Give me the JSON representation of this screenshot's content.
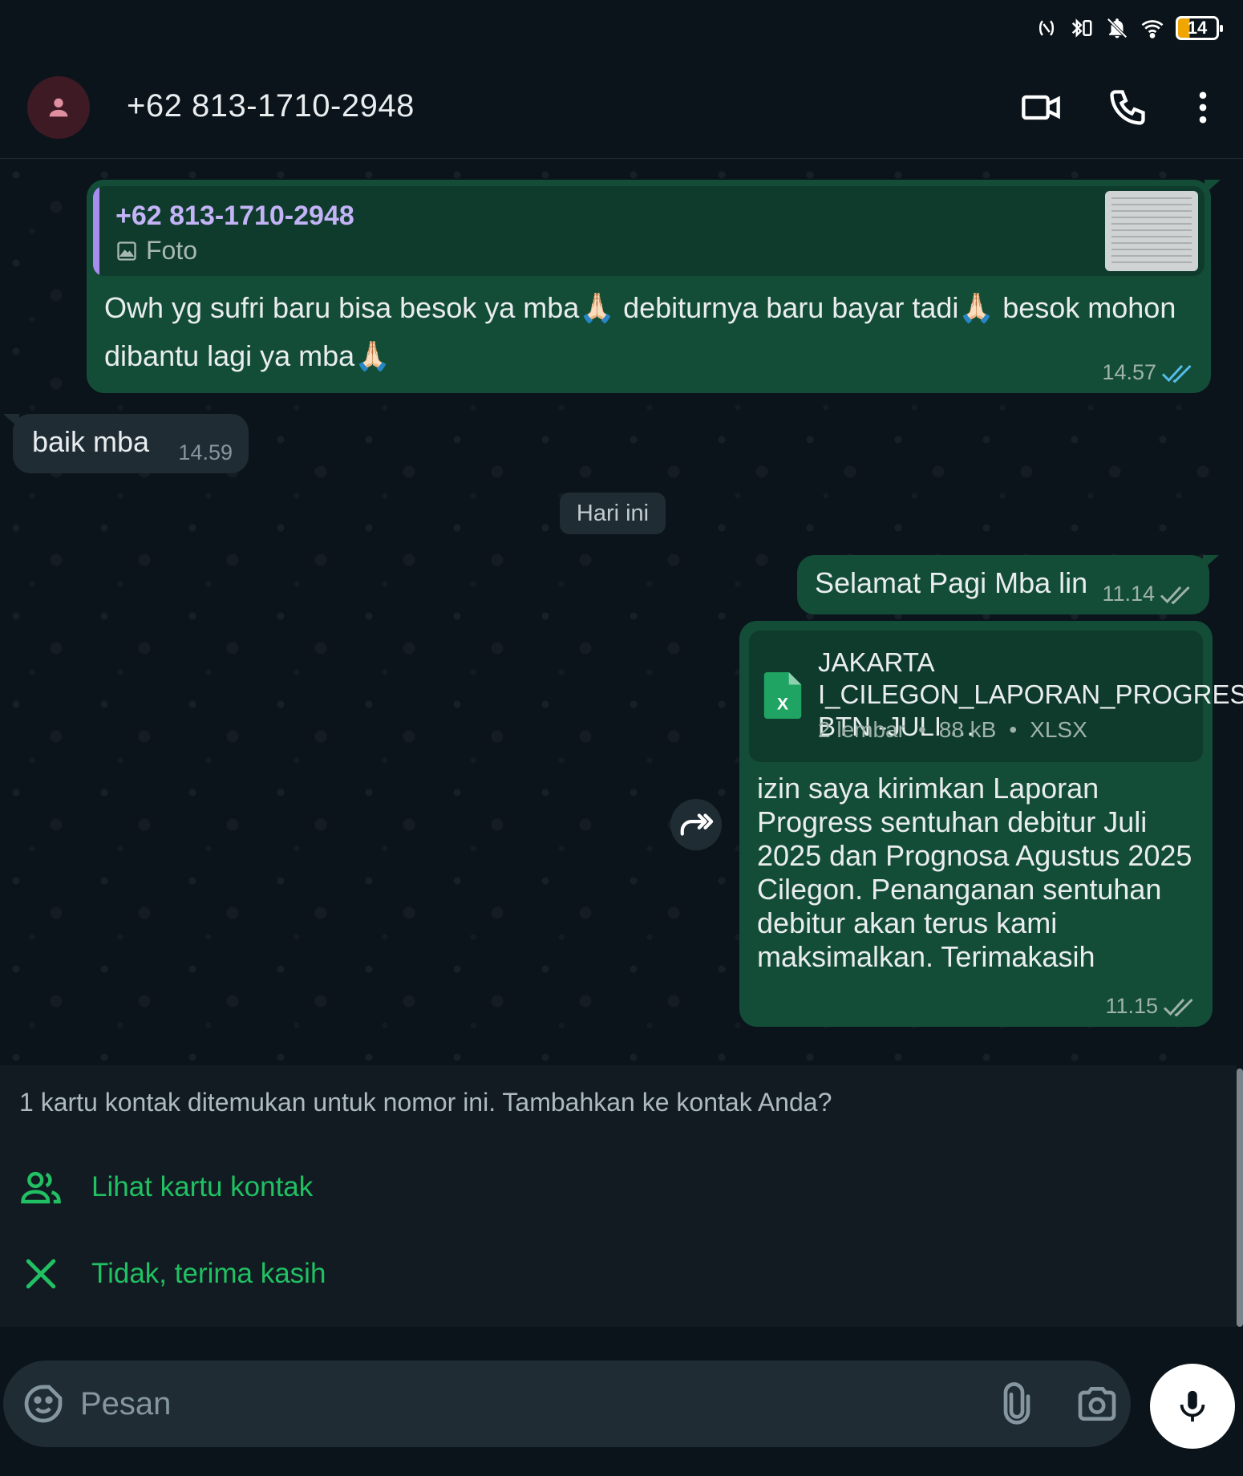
{
  "status_bar": {
    "battery": "14",
    "icons": [
      "nfc-icon",
      "bluetooth-vibrate-icon",
      "bell-off-icon",
      "wifi-icon",
      "battery-icon"
    ]
  },
  "header": {
    "contact_name": "+62 813-1710-2948",
    "icons": [
      "avatar-person-icon",
      "video-call-icon",
      "phone-call-icon",
      "more-options-icon"
    ]
  },
  "messages": [
    {
      "direction": "outgoing",
      "quote": {
        "name": "+62 813-1710-2948",
        "type": "Foto"
      },
      "text": "Owh yg sufri baru bisa besok ya mba🙏🏻 debiturnya baru bayar tadi🙏🏻 besok mohon dibantu lagi ya mba🙏🏻",
      "time": "14.57",
      "status": "read"
    },
    {
      "direction": "incoming",
      "text": "baik mba",
      "time": "14.59"
    },
    {
      "direction": "outgoing",
      "text": "Selamat Pagi Mba lin",
      "time": "11.14",
      "status": "delivered"
    },
    {
      "direction": "outgoing",
      "file": {
        "name": "JAKARTA I_CILEGON_LAPORAN_PROGRESS BTN -JULI …",
        "sheets": "2 lembar",
        "size": "88 kB",
        "ext": "XLSX"
      },
      "text": "izin saya kirimkan Laporan Progress sentuhan debitur Juli 2025 dan Prognosa Agustus 2025 Cilegon. Penanganan sentuhan debitur akan terus kami maksimalkan. Terimakasih",
      "time": "11.15",
      "status": "delivered"
    }
  ],
  "date_divider": "Hari ini",
  "contact_prompt": {
    "message": "1 kartu kontak ditemukan untuk nomor ini. Tambahkan ke kontak Anda?",
    "view_label": "Lihat kartu kontak",
    "dismiss_label": "Tidak, terima kasih"
  },
  "composer": {
    "placeholder": "Pesan"
  },
  "colors": {
    "background": "#0b141a",
    "outgoing_bubble": "#144d37",
    "incoming_bubble": "#1f2c33",
    "accent": "#21c063",
    "read_tick": "#53bdeb"
  }
}
